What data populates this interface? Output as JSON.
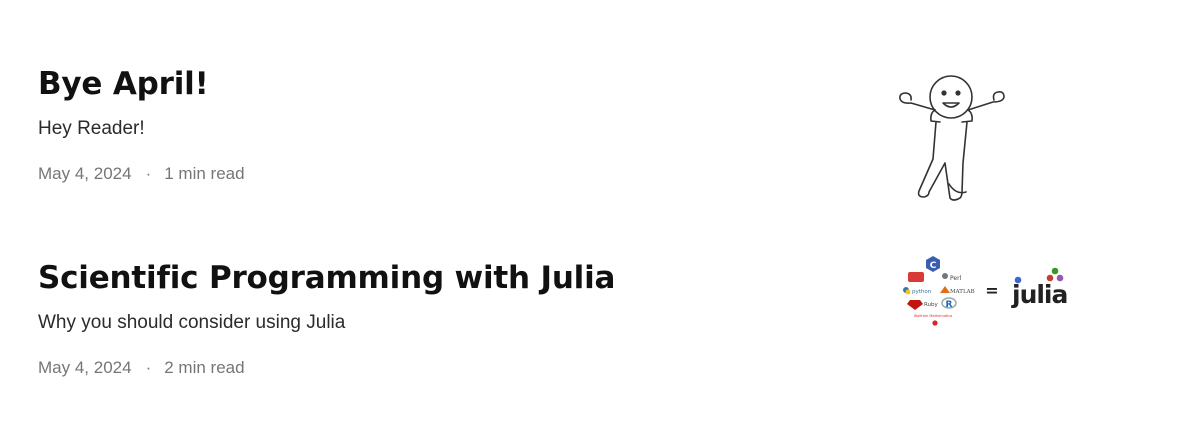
{
  "posts": [
    {
      "title": "Bye April!",
      "subtitle": "Hey Reader!",
      "date": "May 4, 2024",
      "separator": "·",
      "read_time": "1 min read",
      "thumbnail_icon": "stick-figure-icon"
    },
    {
      "title": "Scientific Programming with Julia",
      "subtitle": "Why you should consider using Julia",
      "date": "May 4, 2024",
      "separator": "·",
      "read_time": "2 min read",
      "thumbnail_icon": "languages-equals-julia-icon",
      "thumbnail": {
        "languages": [
          "C",
          "Perl",
          "python",
          "MATLAB",
          "Ruby",
          "R",
          "Wolfram Mathematica"
        ],
        "equals": "=",
        "logo": "julia"
      }
    }
  ],
  "colors": {
    "title": "#111111",
    "subtitle": "#2b2b2b",
    "meta": "#767676",
    "julia_red": "#cb3c33",
    "julia_green": "#389826",
    "julia_purple": "#9558b2"
  }
}
